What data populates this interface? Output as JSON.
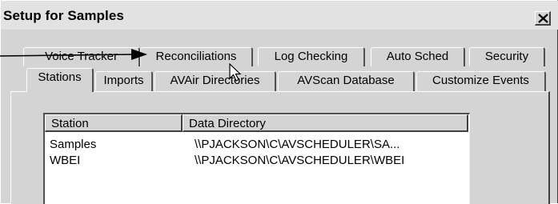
{
  "window": {
    "title": "Setup for Samples"
  },
  "tabs_row1": [
    "Voice Tracker",
    "Reconciliations",
    "Log Checking",
    "Auto Sched",
    "Security"
  ],
  "tabs_row2": [
    "Stations",
    "Imports",
    "AVAir Directories",
    "AVScan Database",
    "Customize Events"
  ],
  "active_tab": "Stations",
  "table": {
    "columns": [
      "Station",
      "Data Directory"
    ],
    "rows": [
      {
        "station": "Samples",
        "directory": "\\\\PJACKSON\\C\\AVSCHEDULER\\SA..."
      },
      {
        "station": "WBEI",
        "directory": "\\\\PJACKSON\\C\\AVSCHEDULER\\WBEI"
      }
    ]
  },
  "icons": {
    "close": "close-icon",
    "annotation": "annotation-arrow-icon",
    "pointer": "mouse-pointer-icon"
  }
}
